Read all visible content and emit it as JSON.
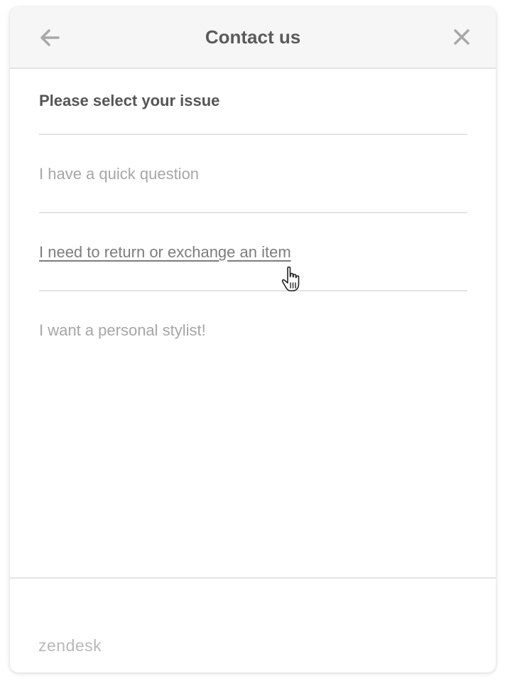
{
  "header": {
    "title": "Contact us",
    "back_icon": "arrow-left-icon",
    "close_icon": "close-icon"
  },
  "form": {
    "prompt": "Please select your issue",
    "options": [
      {
        "label": "I have a quick question"
      },
      {
        "label": "I need to return or exchange an item",
        "hovered": true
      },
      {
        "label": "I want a personal stylist!"
      }
    ]
  },
  "footer": {
    "brand": "zendesk"
  },
  "colors": {
    "header_bg": "#f6f6f6",
    "title": "#5a5a5a",
    "option_text": "#a6a6a6",
    "option_hover": "#7d7d7d",
    "divider": "#e3e3e3",
    "brand": "#b8b8b8"
  }
}
